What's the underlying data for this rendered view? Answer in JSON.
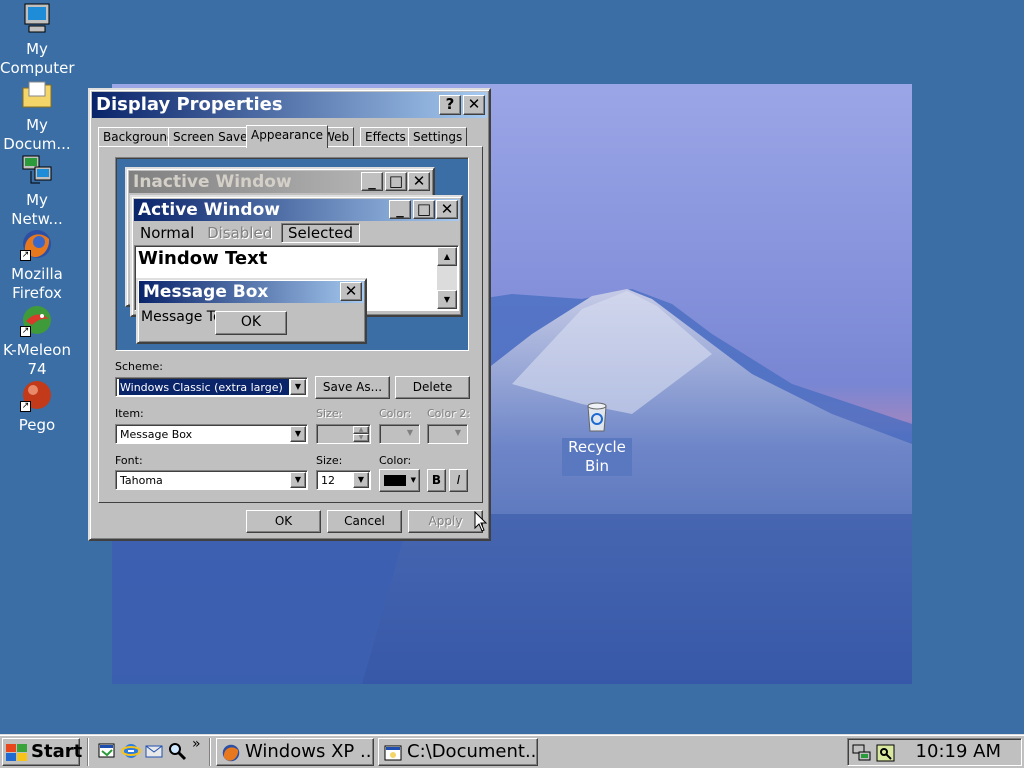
{
  "desktop": {
    "icons": [
      {
        "label": "My Computer",
        "icon": "computer-icon"
      },
      {
        "label": "My Docum...",
        "icon": "documents-folder-icon"
      },
      {
        "label": "My Netw...",
        "icon": "network-icon"
      },
      {
        "label": "Mozilla Firefox",
        "icon": "firefox-icon"
      },
      {
        "label": "K-Meleon 74",
        "icon": "kmeleon-icon"
      },
      {
        "label": "Pego",
        "icon": "pego-icon"
      },
      {
        "label": "Recycle Bin",
        "icon": "recycle-bin-icon"
      }
    ]
  },
  "dialog": {
    "title": "Display Properties",
    "help_btn": "?",
    "close_btn": "✕",
    "tabs": [
      "Background",
      "Screen Saver",
      "Appearance",
      "Web",
      "Effects",
      "Settings"
    ],
    "active_tab": "Appearance",
    "preview": {
      "inactive_title": "Inactive Window",
      "active_title": "Active Window",
      "menu": [
        "Normal",
        "Disabled",
        "Selected"
      ],
      "window_text": "Window Text",
      "msgbox_title": "Message Box",
      "msgbox_text": "Message Text",
      "ok_label": "OK"
    },
    "scheme_label": "Scheme:",
    "scheme_value": "Windows Classic (extra large)",
    "save_as_label": "Save As...",
    "delete_label": "Delete",
    "item_label": "Item:",
    "item_value": "Message Box",
    "item_size_label": "Size:",
    "color_label": "Color:",
    "color2_label": "Color 2:",
    "font_label": "Font:",
    "font_value": "Tahoma",
    "font_size_label": "Size:",
    "font_size_value": "12",
    "font_color_label": "Color:",
    "bold_label": "B",
    "italic_label": "I",
    "ok_label": "OK",
    "cancel_label": "Cancel",
    "apply_label": "Apply"
  },
  "taskbar": {
    "start_label": "Start",
    "quicklaunch": [
      "show-desktop-icon",
      "ie-icon",
      "outlook-icon",
      "search-icon"
    ],
    "chevron": "»",
    "tasks": [
      "Windows XP ...",
      "C:\\Document..."
    ],
    "clock": "10:19 AM"
  },
  "colors": {
    "desktop": "#3a6ea5",
    "titlebar_active": "#0a246a",
    "titlebar_gradient_end": "#a6caf0",
    "face": "#c0c0c0"
  }
}
